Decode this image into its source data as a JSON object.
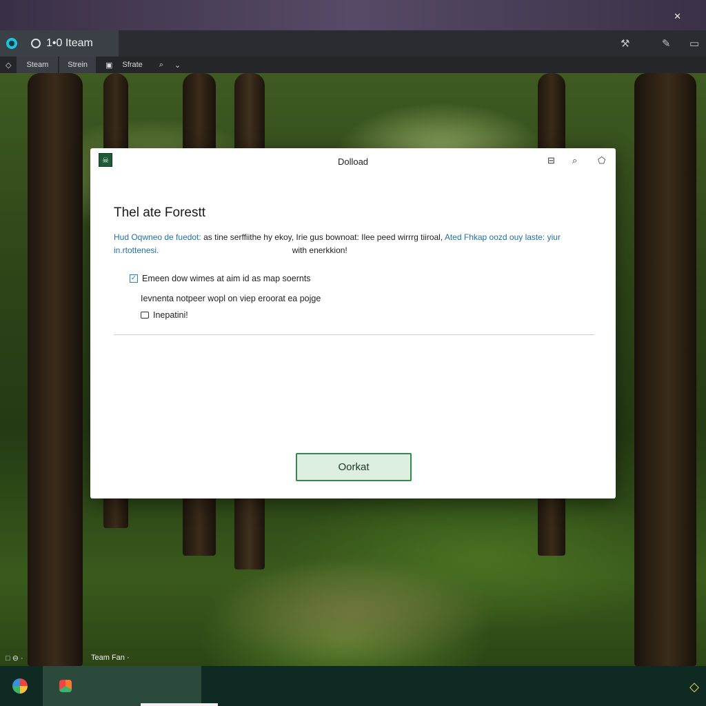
{
  "window": {
    "tab_title": "1•0 Iteam",
    "close_glyph": "✕"
  },
  "toolbar": {
    "items": [
      {
        "label": "Steam"
      },
      {
        "label": "Strein"
      },
      {
        "label": "Sfrate"
      }
    ],
    "right_icons": [
      "hammer-icon",
      "pin-icon",
      "bookmark-icon"
    ]
  },
  "dialog": {
    "title": "Dolload",
    "heading": "Thel ate Forestt",
    "description": {
      "link1": "Hud Oqwneo de fuedot:",
      "text1": "as tine serffiithe hy ekoy, Irie gus bownoat: Ilee peed wirrrg tiiroal,",
      "link2": "Ated Fhkap oozd ouy laste: yiur in.rtottenesi.",
      "text2": "with enerkkion!"
    },
    "option_checkbox": "Emeen dow wimes at aim id as map soernts",
    "option_text": "Ievnenta notpeer wopl on viep eroorat ea pojge",
    "option_folder": "Inepatini!",
    "ok_button": "Oorkat"
  },
  "statusbar": {
    "left": "□ ⊖ ·",
    "mid": "Team Fan ·"
  },
  "colors": {
    "link": "#1f6fa8",
    "ok_border": "#2e8b4a",
    "ok_fill": "#dcefe0",
    "taskbar": "#0f2a22"
  }
}
